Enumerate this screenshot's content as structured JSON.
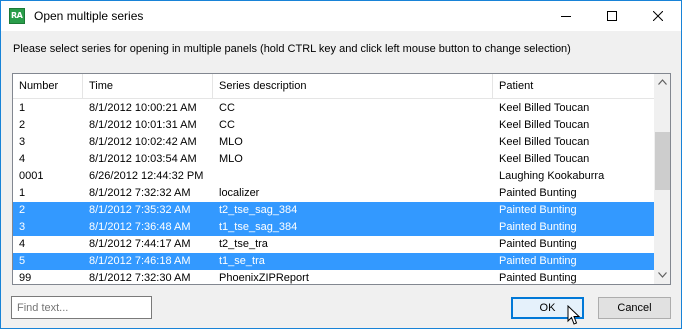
{
  "window": {
    "title": "Open multiple series",
    "icon": "ra-app-icon",
    "controls": [
      "minimize-icon",
      "maximize-icon",
      "close-icon"
    ]
  },
  "instructions": "Please select series for opening in multiple panels (hold CTRL key and click left mouse button to change selection)",
  "table": {
    "columns": [
      "Number",
      "Time",
      "Series description",
      "Patient"
    ],
    "rows": [
      {
        "number": "1",
        "time": "8/1/2012 10:00:21 AM",
        "description": "CC",
        "patient": "Keel Billed Toucan",
        "selected": false
      },
      {
        "number": "2",
        "time": "8/1/2012 10:01:31 AM",
        "description": "CC",
        "patient": "Keel Billed Toucan",
        "selected": false
      },
      {
        "number": "3",
        "time": "8/1/2012 10:02:42 AM",
        "description": "MLO",
        "patient": "Keel Billed Toucan",
        "selected": false
      },
      {
        "number": "4",
        "time": "8/1/2012 10:03:54 AM",
        "description": "MLO",
        "patient": "Keel Billed Toucan",
        "selected": false
      },
      {
        "number": "0001",
        "time": "6/26/2012 12:44:32 PM",
        "description": "",
        "patient": "Laughing Kookaburra",
        "selected": false
      },
      {
        "number": "1",
        "time": "8/1/2012 7:32:32 AM",
        "description": "localizer",
        "patient": "Painted Bunting",
        "selected": false
      },
      {
        "number": "2",
        "time": "8/1/2012 7:35:32 AM",
        "description": "t2_tse_sag_384",
        "patient": "Painted Bunting",
        "selected": true
      },
      {
        "number": "3",
        "time": "8/1/2012 7:36:48 AM",
        "description": "t1_tse_sag_384",
        "patient": "Painted Bunting",
        "selected": true
      },
      {
        "number": "4",
        "time": "8/1/2012 7:44:17 AM",
        "description": "t2_tse_tra",
        "patient": "Painted Bunting",
        "selected": false
      },
      {
        "number": "5",
        "time": "8/1/2012 7:46:18 AM",
        "description": "t1_se_tra",
        "patient": "Painted Bunting",
        "selected": true
      },
      {
        "number": "99",
        "time": "8/1/2012 7:32:30 AM",
        "description": "PhoenixZIPReport",
        "patient": "Painted Bunting",
        "selected": false
      }
    ]
  },
  "find": {
    "placeholder": "Find text...",
    "value": ""
  },
  "buttons": {
    "ok": "OK",
    "cancel": "Cancel"
  },
  "colors": {
    "selection": "#3399ff",
    "accent_border": "#1883d7"
  }
}
